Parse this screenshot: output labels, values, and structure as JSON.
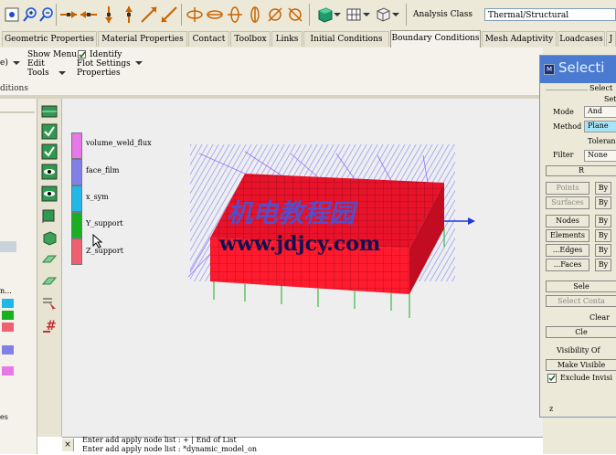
{
  "toolbar": {
    "icons": [
      "node-tool-icon",
      "zoom-in-icon",
      "zoom-out-icon",
      "arrow-right-icon",
      "arrow-left-icon",
      "arrow-down-icon",
      "arrow-up-icon",
      "diagonal-arrow-icon",
      "diagonal-arrow-2-icon",
      "pan-icon",
      "rotate-x-icon",
      "rotate-x2-icon",
      "rotate-y-icon",
      "rotate-y2-icon",
      "rotate-z-icon",
      "rotate-z2-icon",
      "solid-view-icon",
      "mesh-view-icon",
      "wireframe-view-icon"
    ],
    "analysis_class_label": "Analysis Class",
    "analysis_class_value": "Thermal/Structural"
  },
  "tabs": [
    {
      "label": "Geometric Properties"
    },
    {
      "label": "Material Properties"
    },
    {
      "label": "Contact"
    },
    {
      "label": "Toolbox"
    },
    {
      "label": "Links"
    },
    {
      "label": "Initial Conditions"
    },
    {
      "label": "Boundary Conditions",
      "active": true
    },
    {
      "label": "Mesh Adaptivity"
    },
    {
      "label": "Loadcases"
    },
    {
      "label": "J"
    }
  ],
  "ribbon": {
    "left_fragment": "e)",
    "show_menu": "Show Menu",
    "edit": "Edit",
    "tools": "Tools",
    "identify": "Identify",
    "flot_settings": "Flot Settings",
    "properties": "Properties",
    "group_label": "ditions"
  },
  "legend": [
    {
      "label": "volume_weld_flux",
      "color": "#e878e8"
    },
    {
      "label": "face_film",
      "color": "#8080e8"
    },
    {
      "label": "x_sym",
      "color": "#20b8e8"
    },
    {
      "label": "Y_support",
      "color": "#18b020"
    },
    {
      "label": "Z_support",
      "color": "#f06070"
    }
  ],
  "watermark": {
    "line1": "机电教程园",
    "line2": "www.jdjcy.com"
  },
  "console": {
    "close": "×",
    "line1": "Enter add apply node list : + | End of List",
    "line2": "Enter add apply node list : *dynamic_model_on"
  },
  "selection": {
    "title": "Selecti",
    "select_heading": "Select",
    "set_heading": "Set",
    "mode_label": "Mode",
    "mode_value": "And",
    "method_label": "Method",
    "method_value": "Plane",
    "tolerance_label": "Toleran",
    "filter_label": "Filter",
    "filter_value": "None",
    "reset_button": "R",
    "rows": [
      {
        "label": "Points",
        "by": "By"
      },
      {
        "label": "Surfaces",
        "by": "By"
      },
      {
        "label": "Nodes",
        "by": "By"
      },
      {
        "label": "Elements",
        "by": "By"
      },
      {
        "label": "...Edges",
        "by": "By"
      },
      {
        "label": "...Faces",
        "by": "By"
      }
    ],
    "select_button": "Sele",
    "select_contact_button": "Select Conta",
    "clear_heading": "Clear",
    "clear_button": "Cle",
    "visibility_heading": "Visibility Of",
    "make_visible_button": "Make Visible",
    "exclude_invisible": "Exclude Invisi",
    "bottom_mark": "z"
  },
  "left_panel": {
    "fragment_1": "n...",
    "fragment_2": "es"
  }
}
